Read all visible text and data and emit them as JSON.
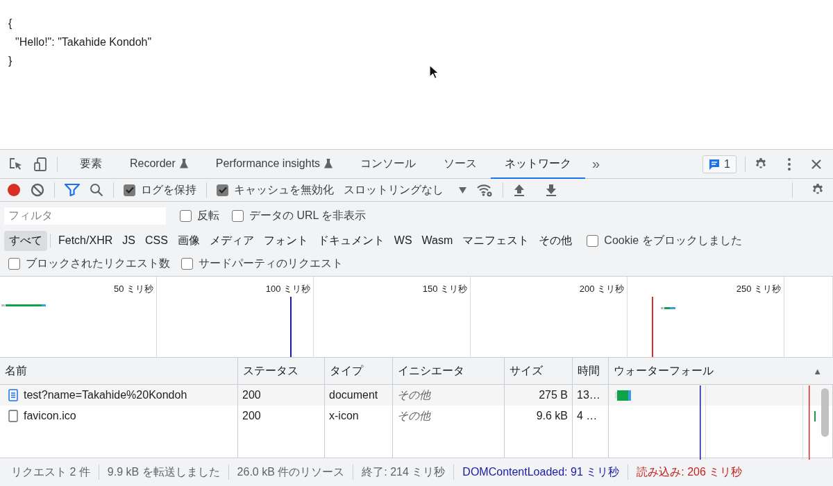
{
  "page": {
    "lines": [
      "{",
      "\"Hello!\": \"Takahide Kondoh\"",
      "}"
    ]
  },
  "devtools": {
    "tabs": [
      {
        "label": "要素",
        "selected": false,
        "kind": "plain"
      },
      {
        "label": "Recorder",
        "selected": false,
        "kind": "experimental"
      },
      {
        "label": "Performance insights",
        "selected": false,
        "kind": "experimental"
      },
      {
        "label": "コンソール",
        "selected": false,
        "kind": "plain"
      },
      {
        "label": "ソース",
        "selected": false,
        "kind": "plain"
      },
      {
        "label": "ネットワーク",
        "selected": true,
        "kind": "plain"
      }
    ],
    "more_tabs": "»",
    "issues_count": "1",
    "toolbar": {
      "recording": true,
      "checkboxes": [
        {
          "label": "ログを保持",
          "checked": true
        },
        {
          "label": "キャッシュを無効化",
          "checked": true
        }
      ],
      "throttling": "スロットリングなし"
    },
    "filter": {
      "placeholder": "フィルタ",
      "checkboxes": [
        {
          "label": "反転",
          "checked": false
        },
        {
          "label": "データの URL を非表示",
          "checked": false
        }
      ]
    },
    "types": [
      {
        "label": "すべて",
        "selected": true
      },
      {
        "label": "Fetch/XHR",
        "selected": false
      },
      {
        "label": "JS",
        "selected": false
      },
      {
        "label": "CSS",
        "selected": false
      },
      {
        "label": "画像",
        "selected": false
      },
      {
        "label": "メディア",
        "selected": false
      },
      {
        "label": "フォント",
        "selected": false
      },
      {
        "label": "ドキュメント",
        "selected": false
      },
      {
        "label": "WS",
        "selected": false
      },
      {
        "label": "Wasm",
        "selected": false
      },
      {
        "label": "マニフェスト",
        "selected": false
      },
      {
        "label": "その他",
        "selected": false
      }
    ],
    "blocked_cookies": {
      "label": "Cookie をブロックしました",
      "checked": false
    },
    "more_checkboxes": [
      {
        "label": "ブロックされたリクエスト数",
        "checked": false
      },
      {
        "label": "サードパーティのリクエスト",
        "checked": false
      }
    ],
    "overview_ticks": [
      "50 ミリ秒",
      "100 ミリ秒",
      "150 ミリ秒",
      "200 ミリ秒",
      "250 ミリ秒"
    ],
    "table": {
      "columns": [
        "名前",
        "ステータス",
        "タイプ",
        "イニシエータ",
        "サイズ",
        "時間",
        "ウォーターフォール"
      ],
      "sort_indicator": "▲",
      "rows": [
        {
          "kind": "document",
          "name": "test?name=Takahide%20Kondoh",
          "status": "200",
          "type": "document",
          "initiator": "その他",
          "size": "275 B",
          "time": "13…"
        },
        {
          "kind": "file",
          "name": "favicon.ico",
          "status": "200",
          "type": "x-icon",
          "initiator": "その他",
          "size": "9.6 kB",
          "time": "4 …"
        }
      ]
    },
    "status_bar": [
      {
        "text": "リクエスト 2 件",
        "color": "#5f6368"
      },
      {
        "text": "9.9 kB を転送しました",
        "color": "#5f6368"
      },
      {
        "text": "26.0 kB 件のリソース",
        "color": "#5f6368"
      },
      {
        "text": "終了: 214 ミリ秒",
        "color": "#5f6368"
      },
      {
        "text": "DOMContentLoaded: 91 ミリ秒",
        "color": "#1a1aa6"
      },
      {
        "text": "読み込み: 206 ミリ秒",
        "color": "#c5221f"
      }
    ]
  }
}
